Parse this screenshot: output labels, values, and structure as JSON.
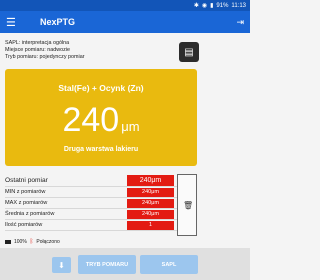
{
  "status_bar": {
    "battery": "91%",
    "time": "11:13"
  },
  "app_bar": {
    "title": "NexPTG"
  },
  "info": {
    "line1": "SAPL: interpretacja ogólna",
    "line2": "Miejsce pomiaru: nadwozie",
    "line3": "Tryb pomiaru: pojedynczy pomiar"
  },
  "panel": {
    "material": "Stal(Fe) + Ocynk (Zn)",
    "value": "240",
    "unit": "μm",
    "layer": "Druga warstwa lakieru"
  },
  "stats": [
    {
      "label": "Ostatni pomiar",
      "value": "240μm"
    },
    {
      "label": "MIN z pomiarów",
      "value": "240μm"
    },
    {
      "label": "MAX z pomiarów",
      "value": "240μm"
    },
    {
      "label": "Średnia z pomiarów",
      "value": "240μm"
    },
    {
      "label": "Ilość pomiarów",
      "value": "1"
    }
  ],
  "device_status": {
    "battery": "100%",
    "connection": "Połączono"
  },
  "buttons": {
    "measure_mode": "TRYB POMIARU",
    "sapl": "SAPL"
  },
  "colors": {
    "primary": "#1a66d6",
    "status_bar": "#1255b8",
    "panel": "#e9ba0f",
    "value_bg": "#e31b12"
  }
}
